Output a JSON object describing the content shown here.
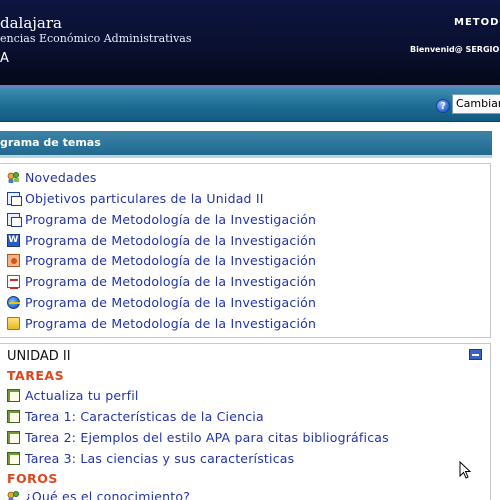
{
  "header": {
    "institution_name": "dalajara",
    "institution_subtitle": "encias Económico Administrativas",
    "institution_letter": "A",
    "course_code": "METODO",
    "welcome": "Bienvenid@ SERGIO"
  },
  "navbar": {
    "help_icon": "help-icon",
    "role_select_value": "Cambiar"
  },
  "section": {
    "title": "grama de temas"
  },
  "topic0": {
    "items": [
      {
        "label": "Novedades",
        "icon": "forum-news-icon"
      },
      {
        "label": "Objetivos particulares de la Unidad II",
        "icon": "page-icon"
      },
      {
        "label": "Programa de Metodología de la Investigación",
        "icon": "page-icon"
      },
      {
        "label": "Programa de Metodología de la Investigación",
        "icon": "word-icon"
      },
      {
        "label": "Programa de Metodología de la Investigación",
        "icon": "powerpoint-icon"
      },
      {
        "label": "Programa de Metodología de la Investigación",
        "icon": "pdf-icon"
      },
      {
        "label": "Programa de Metodología de la Investigación",
        "icon": "web-link-icon"
      },
      {
        "label": "Programa de Metodología de la Investigación",
        "icon": "folder-icon"
      }
    ]
  },
  "unit2": {
    "title": "UNIDAD II",
    "tareas_label": "TAREAS",
    "tareas": [
      {
        "label": "Actualiza tu perfil",
        "icon": "assignment-icon"
      },
      {
        "label": "Tarea 1: Características de la Ciencia",
        "icon": "assignment-icon"
      },
      {
        "label": "Tarea 2: Ejemplos del estilo APA para citas bibliográficas",
        "icon": "assignment-icon"
      },
      {
        "label": "Tarea 3: Las ciencias y sus características",
        "icon": "assignment-icon"
      }
    ],
    "foros_label": "FOROS",
    "foros": [
      {
        "label": "¿Qué es el conocimiento?",
        "icon": "forum-icon"
      }
    ]
  },
  "colors": {
    "header_bg": "#0a1030",
    "navbar_bg": "#1f6f96",
    "link": "#2234a8",
    "category": "#e0461c"
  }
}
